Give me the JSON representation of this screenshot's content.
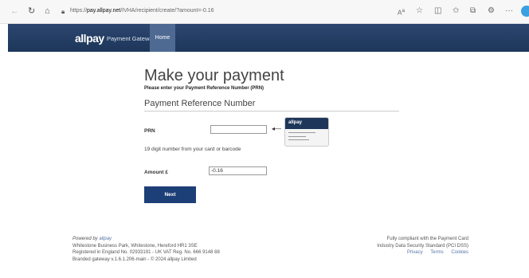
{
  "browser": {
    "url_prefix": "https://",
    "url_host": "pay.allpay.net",
    "url_path": "/IVHA/recipient/create/?amount=-0.16",
    "back_icon": "back-arrow-icon",
    "reload_icon": "reload-icon",
    "home_icon": "home-icon",
    "more_label": "···"
  },
  "header": {
    "logo": "allpay",
    "logo_sub": "Payment Gateway",
    "home_tab": "Home"
  },
  "main": {
    "title": "Make your payment",
    "subtitle": "Please enter your Payment Reference Number (PRN)",
    "section_title": "Payment Reference Number",
    "prn_label": "PRN",
    "prn_value": "",
    "prn_hint": "19 digit number from your card or barcode",
    "amount_label": "Amount £",
    "amount_value": "-0.16",
    "next_button": "Next",
    "card_logo": "allpay"
  },
  "footer": {
    "powered_prefix": "Powered by ",
    "powered_link": "allpay",
    "address": "Whitestone Business Park, Whitestone, Hereford HR1 3SE",
    "registration": "Registered in England No. 02933191 - UK VAT Reg. No. 666 9148 88",
    "version": "Branded gateway v.1.6.1.206-main - © 2024 allpay Limited",
    "compliance_line1": "Fully compliant with the Payment Card",
    "compliance_line2": "Industry Data Security Standard (PCI DSS)",
    "links": [
      "Privacy",
      "Terms",
      "Cookies"
    ]
  }
}
